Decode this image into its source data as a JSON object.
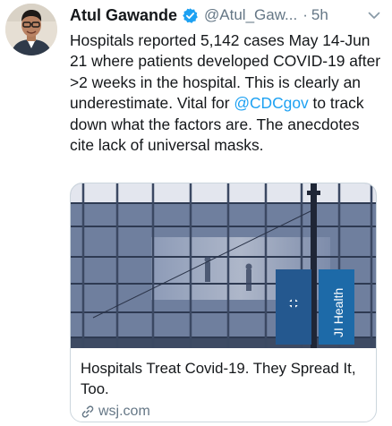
{
  "author": {
    "name": "Atul Gawande",
    "handle": "@Atul_Gaw...",
    "separator": "·",
    "time": "5h"
  },
  "icons": {
    "verified": "verified-badge-icon",
    "caret": "chevron-down-icon",
    "link": "link-icon"
  },
  "colors": {
    "link": "#1da1f2",
    "secondary_text": "#657786",
    "border": "#ccd6dd"
  },
  "tweet": {
    "text_before": "Hospitals reported 5,142 cases May 14-Jun 21 where patients developed COVID-19 after >2 weeks in the hospital. This is clearly an underestimate. Vital for ",
    "mention": "@CDCgov",
    "text_after": " to track down what the factors are. The anecdotes cite lack of universal masks."
  },
  "card": {
    "banner_text": "JI Health",
    "title": "Hospitals Treat Covid-19. They Spread It, Too.",
    "domain": "wsj.com"
  }
}
